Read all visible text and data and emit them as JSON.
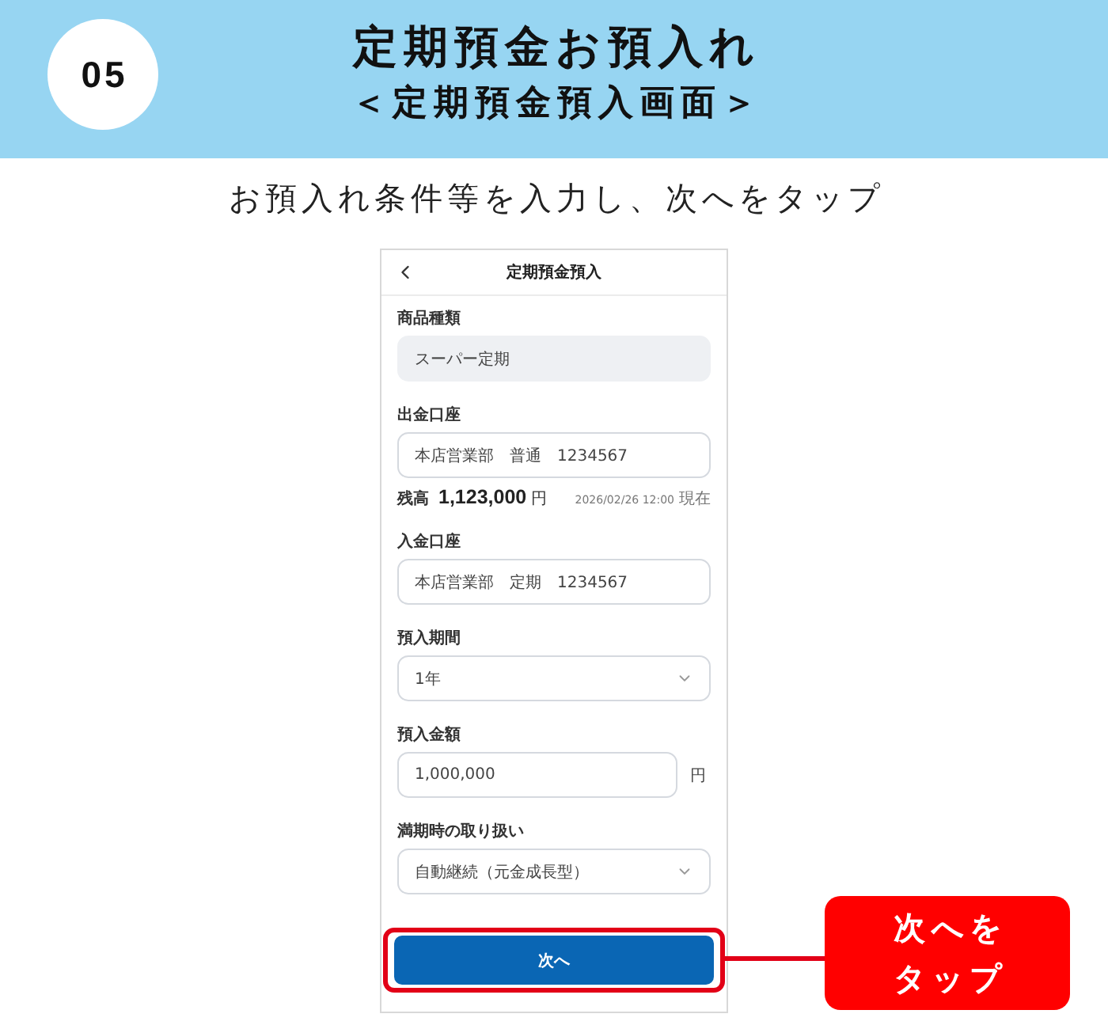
{
  "header": {
    "step": "05",
    "title": "定期預金お預入れ",
    "subtitle": "＜定期預金預入画面＞"
  },
  "instruction": "お預入れ条件等を入力し、次へをタップ",
  "phone": {
    "title": "定期預金預入",
    "fields": [
      {
        "kind": "readonly",
        "label": "商品種類",
        "value": "スーパー定期"
      },
      {
        "kind": "input",
        "label": "出金口座",
        "value": "本店営業部　普通　1234567",
        "balance": {
          "label": "残高",
          "amount": "1,123,000",
          "unit": "円",
          "time": "2026/02/26 12:00",
          "time_suffix": "現在"
        }
      },
      {
        "kind": "input",
        "label": "入金口座",
        "value": "本店営業部　定期　1234567"
      },
      {
        "kind": "select",
        "label": "預入期間",
        "value": "1年"
      },
      {
        "kind": "input",
        "label": "預入金額",
        "value": "1,000,000",
        "unit": "円"
      },
      {
        "kind": "select",
        "label": "満期時の取り扱い",
        "value": "自動継続（元金成長型）"
      }
    ],
    "next_button": {
      "label": "次へ",
      "highlighted": true
    }
  },
  "callout": {
    "lines": [
      "次へを",
      "タップ"
    ]
  }
}
